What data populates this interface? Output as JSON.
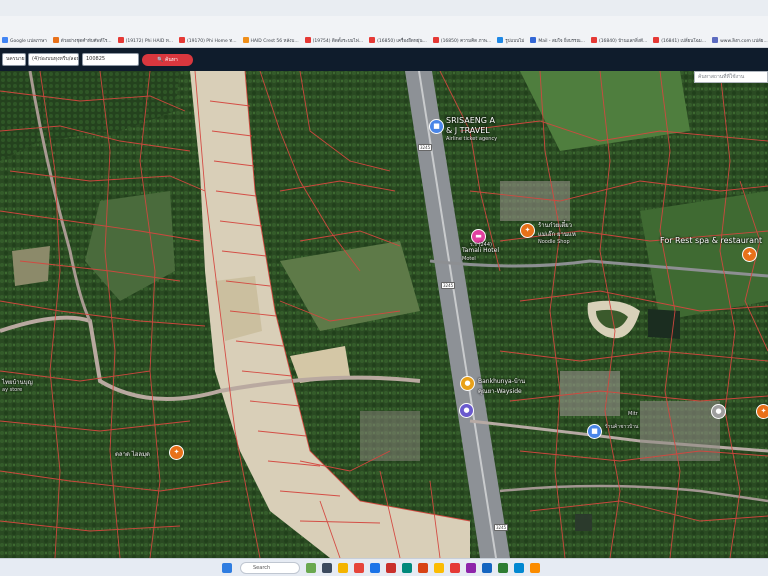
{
  "browser": {
    "bookmarks": [
      {
        "label": "Google แปลภาษา",
        "color": "#4285f4"
      },
      {
        "label": "ตัวอย่างชุดคำทับศัพท์โร...",
        "color": "#e8711a"
      },
      {
        "label": "(19172) Phi HAID ท...",
        "color": "#e53935"
      },
      {
        "label": "(19170) Phi Home ท...",
        "color": "#e53935"
      },
      {
        "label": "HAID Crest 56 หลังบ...",
        "color": "#ef8f1a"
      },
      {
        "label": "(19754) ติดตั้งระบบไฟ...",
        "color": "#e53935"
      },
      {
        "label": "(16850) เครื่องยืดหยุ่น...",
        "color": "#e53935"
      },
      {
        "label": "(16850) ความคิด ภาพ...",
        "color": "#e53935"
      },
      {
        "label": "รูปแบบไม่",
        "color": "#1e88e5"
      },
      {
        "label": "Mail - สมใจ ยิ่งบรรณ...",
        "color": "#3367d6"
      },
      {
        "label": "(16840) บ้านแลกสิ่งดี...",
        "color": "#e53935"
      },
      {
        "label": "(16841) เปลี่ยนโฉม...",
        "color": "#e53935"
      },
      {
        "label": "www.ลิงก.com แปลัย...",
        "color": "#5c6bc0"
      }
    ]
  },
  "toolbar": {
    "province_value": "นครนายก",
    "district_value": "(4)ร่องบนหุงหรีบ/ลอนกาย",
    "parcel_value": "100825",
    "search_label": "ค้นหา"
  },
  "map": {
    "search_placeholder": "ค้นหาสถานที่ที่ใช้งาน",
    "labels": {
      "travel_name": "SRISAENG A",
      "travel_name2": "& J TRAVEL",
      "travel_type": "Airline ticket agency",
      "noodle_name": "ร้านก๋วยเตี๋ยว",
      "noodle_name2": "แม่เอ๊ก ยานแห",
      "noodle_type": "Noodle Shop",
      "hotel_name": "Tamali Hotel",
      "hotel_rating": "ร.ร (244)",
      "hotel_type": "Motel",
      "spa": "For Rest spa & restaurant",
      "bankhunya": "Bankhunya-บ้าน",
      "bankhunya2": "คุณยา-Wayside",
      "shop_left": "ไทยบ้านบุญ",
      "shop_left2": "ay store",
      "market": "ตลาด ไฮลมุด",
      "right_place1": "Mitr",
      "right_place2": "ร้านค้าชาวบ้าน"
    },
    "road_shields": [
      "3245",
      "3245",
      "3245"
    ]
  },
  "taskbar": {
    "search_label": "Search"
  }
}
